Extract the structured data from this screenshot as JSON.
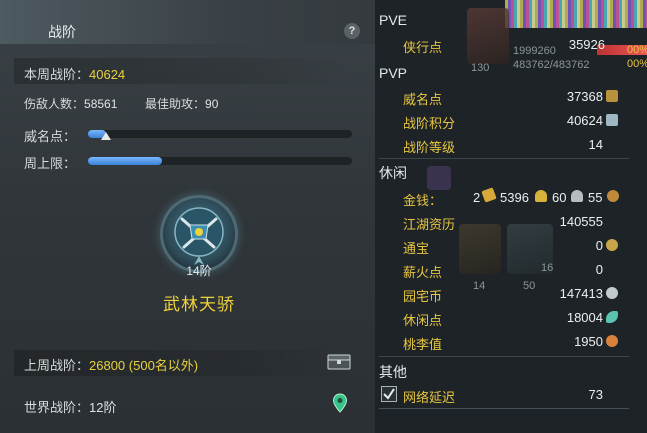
{
  "left": {
    "title": "战阶",
    "help": "?",
    "weekly": {
      "label": "本周战阶：",
      "value": "40624"
    },
    "kills": {
      "label": "伤敌人数：",
      "value": "58561"
    },
    "assist": {
      "label": "最佳助攻：",
      "value": "90"
    },
    "fame": {
      "label": "威名点：",
      "fraction": 0.07
    },
    "weekly_cap": {
      "label": "周上限：",
      "fraction": 0.28
    },
    "badge_tier": "14阶",
    "rank_name": "武林天骄",
    "last_week": {
      "label": "上周战阶：",
      "value": "26800 (500名以外)"
    },
    "world": {
      "label": "世界战阶：",
      "value": "12阶"
    }
  },
  "right": {
    "pve": {
      "title": "PVE",
      "items": [
        {
          "name": "侠行点",
          "value": "35926"
        }
      ]
    },
    "pvp": {
      "title": "PVP",
      "items": [
        {
          "name": "威名点",
          "value": "37368"
        },
        {
          "name": "战阶积分",
          "value": "40624"
        },
        {
          "name": "战阶等级",
          "value": "14"
        }
      ]
    },
    "leisure": {
      "title": "休闲",
      "money": {
        "name": "金钱：",
        "gold_bars": "2",
        "gold": "5396",
        "silver": "60",
        "copper": "55"
      },
      "items": [
        {
          "name": "江湖资历",
          "value": "140555"
        },
        {
          "name": "通宝",
          "value": "0"
        },
        {
          "name": "薪火点",
          "value": "0"
        },
        {
          "name": "园宅币",
          "value": "147413"
        },
        {
          "name": "休闲点",
          "value": "18004"
        },
        {
          "name": "桃李值",
          "value": "1950"
        }
      ]
    },
    "other": {
      "title": "其他",
      "items": [
        {
          "name": "网络延迟",
          "value": "73"
        }
      ]
    },
    "ghost": {
      "a": "1999260",
      "b": "483762/483762",
      "pct1": "00%",
      "pct2": "00%",
      "n130": "130",
      "n14": "14",
      "n50": "50",
      "n16": "16"
    }
  },
  "colors": {
    "accent_yellow": "#e8d23f",
    "label_gold": "#e7c642",
    "bar_blue": "#3b82d8"
  }
}
